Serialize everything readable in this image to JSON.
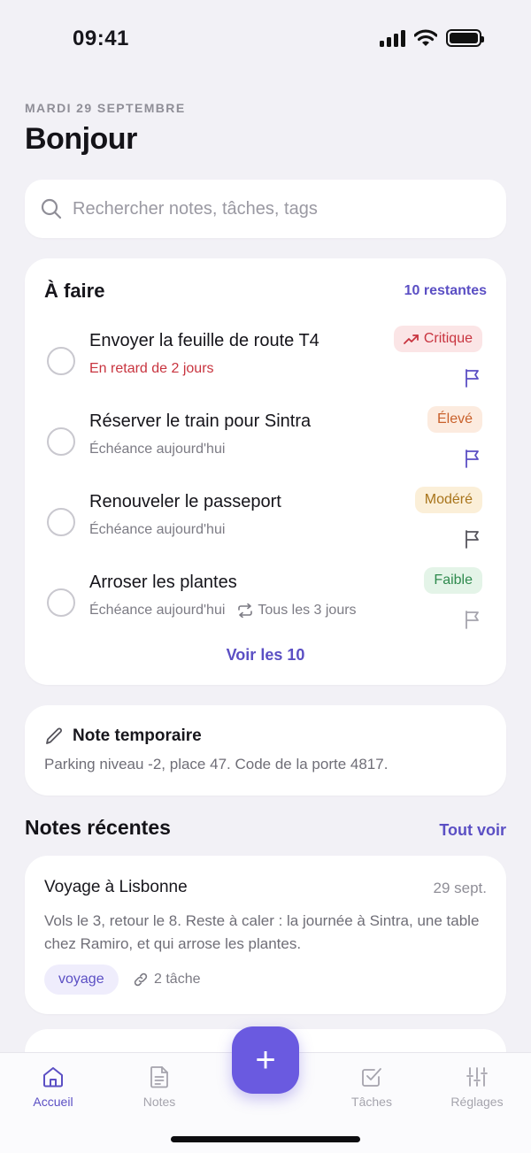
{
  "status_bar": {
    "time": "09:41"
  },
  "header": {
    "date": "MARDI 29 SEPTEMBRE",
    "greeting": "Bonjour"
  },
  "search": {
    "placeholder": "Rechercher notes, tâches, tags",
    "icon": "search-icon"
  },
  "todo": {
    "title": "À faire",
    "remaining": "10 restantes",
    "tasks": [
      {
        "title": "Envoyer la feuille de route T4",
        "subtitle": "En retard de 2 jours",
        "priority": "Critique",
        "priority_color": "#c8343f",
        "priority_bg": "#fbe5e6",
        "flag_color": "#5b4fc4",
        "overdue": true
      },
      {
        "title": "Réserver le train pour Sintra",
        "subtitle": "Échéance aujourd'hui",
        "priority": "Élevé",
        "priority_color": "#c9612b",
        "priority_bg": "#fcebdf",
        "flag_color": "#5b4fc4"
      },
      {
        "title": "Renouveler le passeport",
        "subtitle": "Échéance aujourd'hui",
        "priority": "Modéré",
        "priority_color": "#a8741a",
        "priority_bg": "#fbefd8",
        "flag_color": "#55545c"
      },
      {
        "title": "Arroser les plantes",
        "subtitle": "Échéance aujourd'hui",
        "repeat": "Tous les 3 jours",
        "priority": "Faible",
        "priority_color": "#2f8a4e",
        "priority_bg": "#e4f4e8",
        "flag_color": "#a5a4ad"
      }
    ],
    "see_all": "Voir les 10"
  },
  "temp_note": {
    "title": "Note temporaire",
    "body": "Parking niveau -2, place 47. Code de la porte 4817.",
    "icon": "pencil-icon"
  },
  "recent": {
    "title": "Notes récentes",
    "see_all": "Tout voir",
    "notes": [
      {
        "title": "Voyage à Lisbonne",
        "date": "29 sept.",
        "body": "Vols le 3, retour le 8. Reste à caler : la journée à Sintra, une table chez Ramiro, et qui arrose les plantes.",
        "tag": "voyage",
        "links": "2 tâche"
      }
    ]
  },
  "tabbar": {
    "tabs": [
      {
        "label": "Accueil",
        "icon": "home-icon",
        "active": true
      },
      {
        "label": "Notes",
        "icon": "document-icon"
      },
      {
        "label": "Tâches",
        "icon": "checkbox-icon"
      },
      {
        "label": "Réglages",
        "icon": "sliders-icon"
      }
    ],
    "fab_label": "+"
  },
  "colors": {
    "accent": "#5b4fc4",
    "fab": "#6a5ae0",
    "background": "#f2f1f6"
  }
}
